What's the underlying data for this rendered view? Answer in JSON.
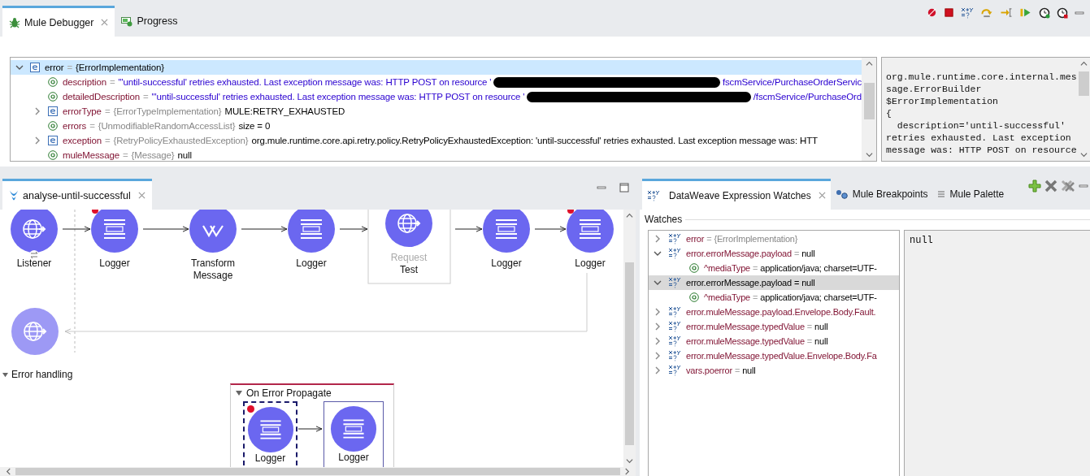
{
  "debugger_tabs": [
    {
      "label": "Mule Debugger",
      "selected": true
    },
    {
      "label": "Progress",
      "selected": false
    }
  ],
  "variables": [
    {
      "kind": "object",
      "name": "error",
      "equals": "=",
      "type": "{ErrorImplementation}",
      "expanded": true,
      "selected": true,
      "children": [
        {
          "kind": "attribute",
          "name": "description",
          "equals": "=",
          "value": "\"'until-successful' retries exhausted. Last exception message was: HTTP POST on resource '",
          "string": true,
          "redacted": true,
          "value_tail": "fscmService/PurchaseOrderServic",
          "selected": false
        },
        {
          "kind": "attribute",
          "name": "detailedDescription",
          "equals": "=",
          "value": "\"'until-successful' retries exhausted. Last exception message was: HTTP POST on resource '",
          "string": true,
          "redacted": true,
          "value_tail": "/fscmService/PurchaseOrd",
          "selected": false
        },
        {
          "kind": "object",
          "name": "errorType",
          "equals": "=",
          "type": "{ErrorTypeImplementation}",
          "value": "MULE:RETRY_EXHAUSTED",
          "string": false,
          "expanded": false,
          "selected": false
        },
        {
          "kind": "attribute",
          "name": "errors",
          "equals": "=",
          "type": "{UnmodifiableRandomAccessList}",
          "value": "size = 0",
          "string": false,
          "selected": false
        },
        {
          "kind": "object",
          "name": "exception",
          "equals": "=",
          "type": "{RetryPolicyExhaustedException}",
          "value": "org.mule.runtime.core.api.retry.policy.RetryPolicyExhaustedException: 'until-successful' retries exhausted. Last exception message was: HTT",
          "string": false,
          "expanded": false,
          "selected": false
        },
        {
          "kind": "attribute",
          "name": "muleMessage",
          "equals": "=",
          "type": "{Message}",
          "value": "null",
          "string": false,
          "selected": false
        }
      ]
    }
  ],
  "details": [
    "org.mule.runtime.core.internal.mes",
    "sage.ErrorBuilder",
    "$ErrorImplementation",
    "{",
    "  description='until-successful'",
    "retries exhausted. Last exception",
    "message was: HTTP POST on resource"
  ],
  "flow_tabs": [
    {
      "label": "analyse-until-successful",
      "selected": true
    }
  ],
  "flow": {
    "nodes": [
      {
        "kind": "listener",
        "label": "Listener",
        "breakpoint": false
      },
      {
        "kind": "logger",
        "label": "Logger",
        "breakpoint": true
      },
      {
        "kind": "transform",
        "label": "Transform Message",
        "breakpoint": false
      },
      {
        "kind": "logger",
        "label": "Logger",
        "breakpoint": false
      },
      {
        "kind": "request",
        "operation": "Request",
        "label": "Test",
        "breakpoint": false
      },
      {
        "kind": "logger",
        "label": "Logger",
        "breakpoint": false
      },
      {
        "kind": "logger",
        "label": "Logger",
        "breakpoint": true
      }
    ],
    "error_handling": {
      "label": "Error handling",
      "expanded": true,
      "handler": {
        "label": "On Error Propagate",
        "expanded": true,
        "nodes": [
          {
            "kind": "logger",
            "label": "Logger",
            "breakpoint": true,
            "current": true,
            "selected": false
          },
          {
            "kind": "logger",
            "label": "Logger",
            "breakpoint": false,
            "current": false,
            "selected": true
          }
        ]
      }
    }
  },
  "watch_tabs": [
    {
      "label": "DataWeave Expression Watches",
      "selected": true,
      "kind": "watches"
    },
    {
      "label": "Mule Breakpoints",
      "selected": false,
      "kind": "breakpoints"
    },
    {
      "label": "Mule Palette",
      "selected": false,
      "kind": "palette"
    }
  ],
  "watches_label": "Watches",
  "watches": [
    {
      "expression": "error",
      "equals": "=",
      "type": "{ErrorImplementation}",
      "expanded": false,
      "selected": false
    },
    {
      "expression": "error.errorMessage.payload",
      "equals": "=",
      "value": "null",
      "expanded": true,
      "selected": false,
      "children": [
        {
          "name": "^mediaType",
          "equals": "=",
          "value": "application/java; charset=UTF-"
        }
      ]
    },
    {
      "expression": "error.errorMessage.payload",
      "equals": "=",
      "value": "null",
      "expanded": true,
      "selected": true,
      "children": [
        {
          "name": "^mediaType",
          "equals": "=",
          "value": "application/java; charset=UTF-"
        }
      ]
    },
    {
      "expression": "error.muleMessage.payload.Envelope.Body.Fault.",
      "expanded": false,
      "selected": false
    },
    {
      "expression": "error.muleMessage.typedValue",
      "equals": "=",
      "value": "null",
      "expanded": false,
      "selected": false
    },
    {
      "expression": "error.muleMessage.typedValue",
      "equals": "=",
      "value": "null",
      "expanded": false,
      "selected": false
    },
    {
      "expression": "error.muleMessage.typedValue.Envelope.Body.Fa",
      "expanded": false,
      "selected": false
    },
    {
      "expression": "vars.poerror",
      "equals": "=",
      "value": "null",
      "expanded": false,
      "selected": false
    }
  ],
  "watch_value": "null"
}
